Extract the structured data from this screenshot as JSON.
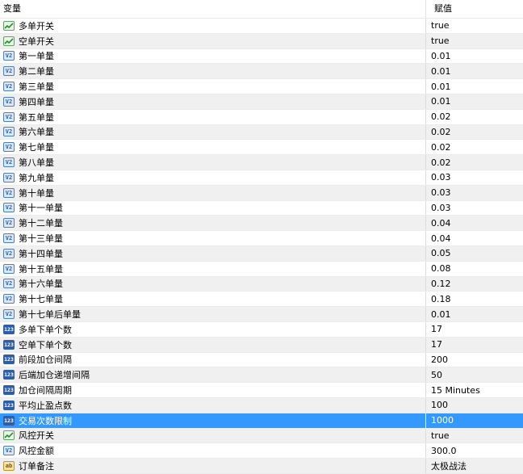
{
  "header": {
    "col_variable": "变量",
    "col_value": "赋值"
  },
  "rows": [
    {
      "icon": "bool-icon",
      "name": "多单开关",
      "value": "true"
    },
    {
      "icon": "bool-icon",
      "name": "空单开关",
      "value": "true"
    },
    {
      "icon": "va-icon",
      "name": "第一单量",
      "value": "0.01"
    },
    {
      "icon": "va-icon",
      "name": "第二单量",
      "value": "0.01"
    },
    {
      "icon": "va-icon",
      "name": "第三单量",
      "value": "0.01"
    },
    {
      "icon": "va-icon",
      "name": "第四单量",
      "value": "0.01"
    },
    {
      "icon": "va-icon",
      "name": "第五单量",
      "value": "0.02"
    },
    {
      "icon": "va-icon",
      "name": "第六单量",
      "value": "0.02"
    },
    {
      "icon": "va-icon",
      "name": "第七单量",
      "value": "0.02"
    },
    {
      "icon": "va-icon",
      "name": "第八单量",
      "value": "0.02"
    },
    {
      "icon": "va-icon",
      "name": "第九单量",
      "value": "0.03"
    },
    {
      "icon": "va-icon",
      "name": "第十单量",
      "value": "0.03"
    },
    {
      "icon": "va-icon",
      "name": "第十一单量",
      "value": "0.03"
    },
    {
      "icon": "va-icon",
      "name": "第十二单量",
      "value": "0.04"
    },
    {
      "icon": "va-icon",
      "name": "第十三单量",
      "value": "0.04"
    },
    {
      "icon": "va-icon",
      "name": "第十四单量",
      "value": "0.05"
    },
    {
      "icon": "va-icon",
      "name": "第十五单量",
      "value": "0.08"
    },
    {
      "icon": "va-icon",
      "name": "第十六单量",
      "value": "0.12"
    },
    {
      "icon": "va-icon",
      "name": "第十七单量",
      "value": "0.18"
    },
    {
      "icon": "va-icon",
      "name": "第十七单后单量",
      "value": "0.01"
    },
    {
      "icon": "int-icon",
      "name": "多单下单个数",
      "value": "17"
    },
    {
      "icon": "int-icon",
      "name": "空单下单个数",
      "value": "17"
    },
    {
      "icon": "int-icon",
      "name": "前段加仓间隔",
      "value": "200"
    },
    {
      "icon": "int-icon",
      "name": "后端加仓递增间隔",
      "value": "50"
    },
    {
      "icon": "int-icon",
      "name": "加仓间隔周期",
      "value": "15 Minutes"
    },
    {
      "icon": "int-icon",
      "name": "平均止盈点数",
      "value": "100"
    },
    {
      "icon": "int-icon",
      "name": "交易次数限制",
      "value": "1000",
      "selected": true
    },
    {
      "icon": "bool-icon",
      "name": "风控开关",
      "value": "true"
    },
    {
      "icon": "va-icon",
      "name": "风控金额",
      "value": "300.0"
    },
    {
      "icon": "str-icon",
      "name": "订单备注",
      "value": "太极战法"
    }
  ],
  "icon_glyphs": {
    "va": "V2",
    "int": "123",
    "str": "ab"
  },
  "colors": {
    "selection": "#3399ff",
    "stripe": "#f0f0f0"
  }
}
